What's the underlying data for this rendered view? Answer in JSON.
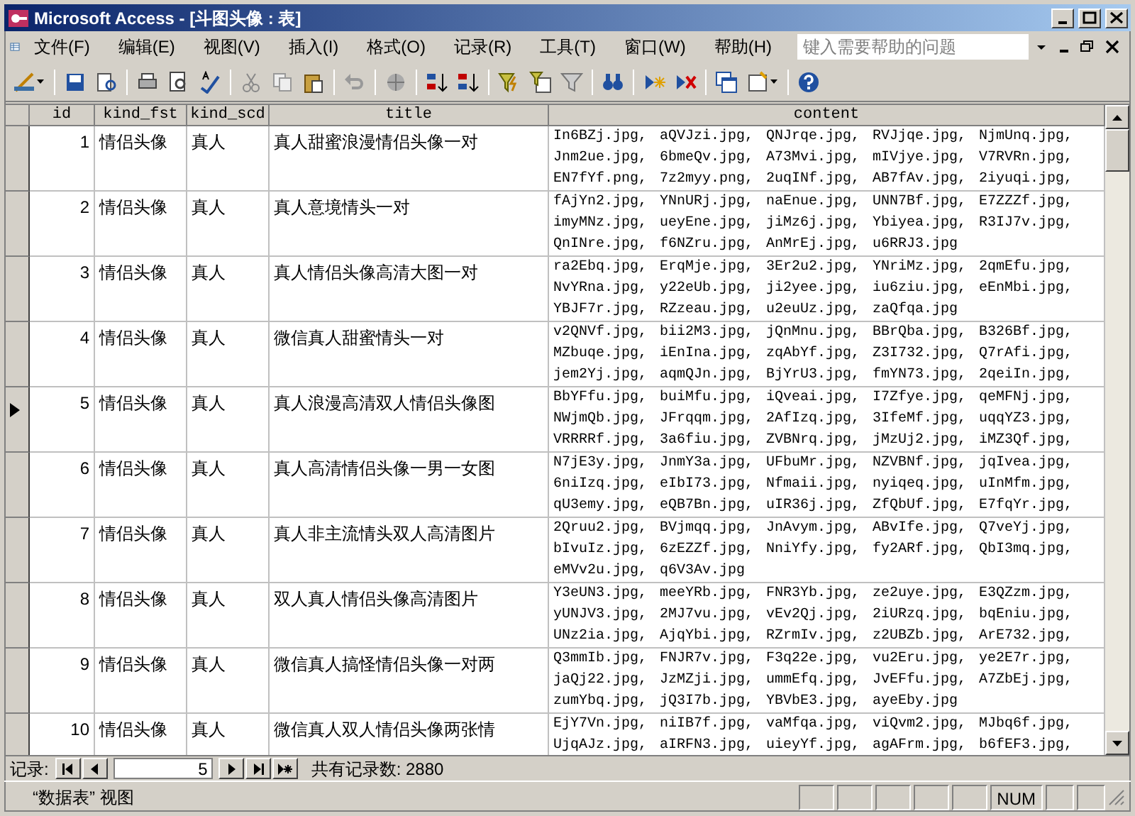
{
  "window": {
    "title": "Microsoft Access - [斗图头像 : 表]"
  },
  "menu": [
    "文件(F)",
    "编辑(E)",
    "视图(V)",
    "插入(I)",
    "格式(O)",
    "记录(R)",
    "工具(T)",
    "窗口(W)",
    "帮助(H)"
  ],
  "help_box": {
    "placeholder": "键入需要帮助的问题"
  },
  "table": {
    "columns": [
      "id",
      "kind_fst",
      "kind_scd",
      "title",
      "content"
    ],
    "rows": [
      {
        "id": "1",
        "kind_fst": "情侣头像",
        "kind_scd": "真人",
        "title": "真人甜蜜浪漫情侣头像一对",
        "selected": false,
        "content": [
          "In6BZj.jpg, aQVJzi.jpg, QNJrqe.jpg, RVJjqe.jpg, NjmUnq.jpg,",
          "Jnm2ue.jpg, 6bmeQv.jpg, A73Mvi.jpg, mIVjye.jpg, V7RVRn.jpg,",
          "EN7fYf.png, 7z2myy.png, 2uqINf.jpg, AB7fAv.jpg, 2iyuqi.jpg,"
        ]
      },
      {
        "id": "2",
        "kind_fst": "情侣头像",
        "kind_scd": "真人",
        "title": "真人意境情头一对",
        "selected": false,
        "content": [
          "fAjYn2.jpg, YNnURj.jpg, naEnue.jpg, UNN7Bf.jpg, E7ZZZf.jpg,",
          "imyMNz.jpg, ueyEne.jpg, jiMz6j.jpg, Ybiyea.jpg, R3IJ7v.jpg,",
          "QnINre.jpg, f6NZru.jpg, AnMrEj.jpg, u6RRJ3.jpg"
        ]
      },
      {
        "id": "3",
        "kind_fst": "情侣头像",
        "kind_scd": "真人",
        "title": "真人情侣头像高清大图一对",
        "selected": false,
        "content": [
          "ra2Ebq.jpg, ErqMje.jpg, 3Er2u2.jpg, YNriMz.jpg, 2qmEfu.jpg,",
          "NvYRna.jpg, y22eUb.jpg, ji2yee.jpg, iu6ziu.jpg, eEnMbi.jpg,",
          "YBJF7r.jpg, RZzeau.jpg, u2euUz.jpg, zaQfqa.jpg"
        ]
      },
      {
        "id": "4",
        "kind_fst": "情侣头像",
        "kind_scd": "真人",
        "title": "微信真人甜蜜情头一对",
        "selected": false,
        "content": [
          "v2QNVf.jpg, bii2M3.jpg, jQnMnu.jpg, BBrQba.jpg, B326Bf.jpg,",
          "MZbuqe.jpg, iEnIna.jpg, zqAbYf.jpg, Z3I732.jpg, Q7rAfi.jpg,",
          "jem2Yj.jpg, aqmQJn.jpg, BjYrU3.jpg, fmYN73.jpg, 2qeiIn.jpg,"
        ]
      },
      {
        "id": "5",
        "kind_fst": "情侣头像",
        "kind_scd": "真人",
        "title": "真人浪漫高清双人情侣头像图",
        "selected": true,
        "content": [
          "BbYFfu.jpg, buiMfu.jpg, iQveai.jpg, I7Zfye.jpg, qeMFNj.jpg,",
          "NWjmQb.jpg, JFrqqm.jpg, 2AfIzq.jpg, 3IfeMf.jpg, uqqYZ3.jpg,",
          "VRRRRf.jpg, 3a6fiu.jpg, ZVBNrq.jpg, jMzUj2.jpg, iMZ3Qf.jpg,"
        ]
      },
      {
        "id": "6",
        "kind_fst": "情侣头像",
        "kind_scd": "真人",
        "title": "真人高清情侣头像一男一女图",
        "selected": false,
        "content": [
          "N7jE3y.jpg, JnmY3a.jpg, UFbuMr.jpg, NZVBNf.jpg, jqIvea.jpg,",
          "6niIzq.jpg, eIbI73.jpg, Nfmaii.jpg, nyiqeq.jpg, uInMfm.jpg,",
          "qU3emy.jpg, eQB7Bn.jpg, uIR36j.jpg, ZfQbUf.jpg, E7fqYr.jpg,"
        ]
      },
      {
        "id": "7",
        "kind_fst": "情侣头像",
        "kind_scd": "真人",
        "title": "真人非主流情头双人高清图片",
        "selected": false,
        "content": [
          "2Qruu2.jpg, BVjmqq.jpg, JnAvym.jpg, ABvIfe.jpg, Q7veYj.jpg,",
          "bIvuIz.jpg, 6zEZZf.jpg, NniYfy.jpg, fy2ARf.jpg, QbI3mq.jpg,",
          "eMVv2u.jpg, q6V3Av.jpg"
        ]
      },
      {
        "id": "8",
        "kind_fst": "情侣头像",
        "kind_scd": "真人",
        "title": "双人真人情侣头像高清图片",
        "selected": false,
        "content": [
          "Y3eUN3.jpg, meeYRb.jpg, FNR3Yb.jpg, ze2uye.jpg, E3QZzm.jpg,",
          "yUNJV3.jpg, 2MJ7vu.jpg, vEv2Qj.jpg, 2iURzq.jpg, bqEniu.jpg,",
          "UNz2ia.jpg, AjqYbi.jpg, RZrmIv.jpg, z2UBZb.jpg, ArE732.jpg,"
        ]
      },
      {
        "id": "9",
        "kind_fst": "情侣头像",
        "kind_scd": "真人",
        "title": "微信真人搞怪情侣头像一对两",
        "selected": false,
        "content": [
          "Q3mmIb.jpg, FNJR7v.jpg, F3q22e.jpg, vu2Eru.jpg, ye2E7r.jpg,",
          "jaQj22.jpg, JzMZji.jpg, ummEfq.jpg, JvEFfu.jpg, A7ZbEj.jpg,",
          "zumYbq.jpg, jQ3I7b.jpg, YBVbE3.jpg, ayeEby.jpg"
        ]
      },
      {
        "id": "10",
        "kind_fst": "情侣头像",
        "kind_scd": "真人",
        "title": "微信真人双人情侣头像两张情",
        "selected": false,
        "content": [
          "EjY7Vn.jpg, niIB7f.jpg, vaMfqa.jpg, viQvm2.jpg, MJbq6f.jpg,",
          "UjqAJz.jpg, aIRFN3.jpg, uieyYf.jpg, agAFrm.jpg, b6fEF3.jpg,"
        ]
      }
    ]
  },
  "record_nav": {
    "label": "记录:",
    "current": "5",
    "total": "共有记录数: 2880"
  },
  "status_bar": {
    "view": "“数据表” 视图",
    "num": "NUM"
  }
}
